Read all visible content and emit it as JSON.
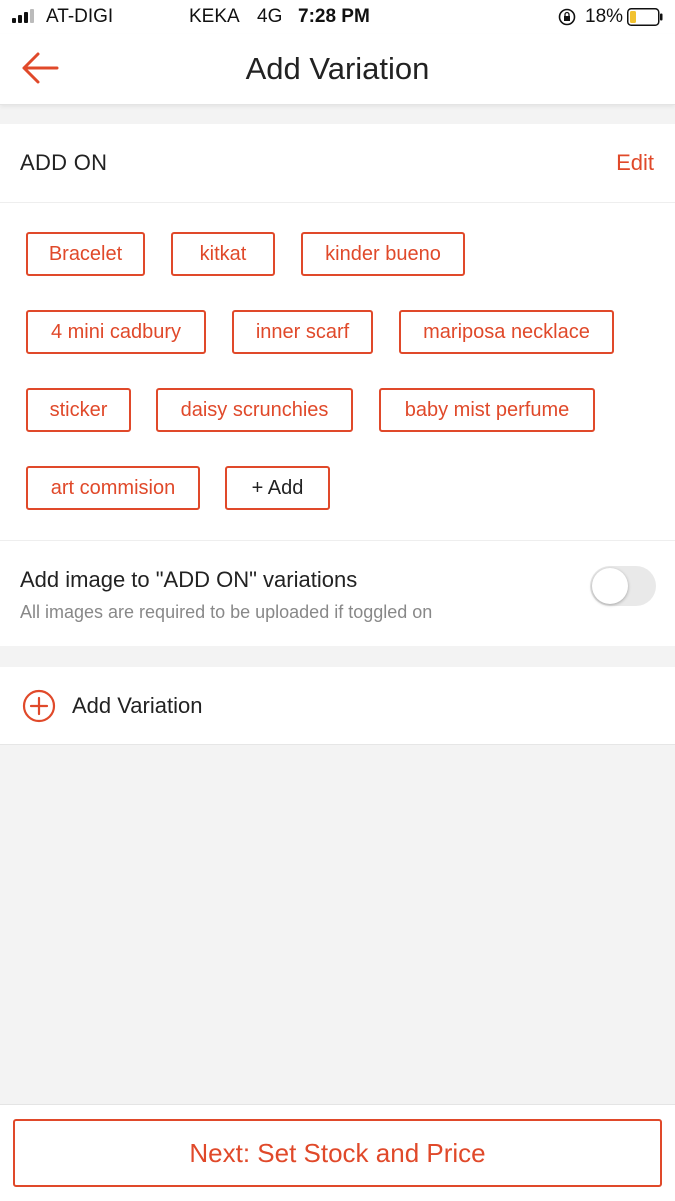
{
  "status_bar": {
    "carrier": "AT-DIGI",
    "carrier_secondary": "KEKA",
    "network": "4G",
    "time": "7:28 PM",
    "battery": "18%"
  },
  "header": {
    "title": "Add Variation",
    "back_icon": "arrow-left-icon"
  },
  "variation": {
    "name": "ADD ON",
    "edit_label": "Edit",
    "options": [
      "Bracelet",
      "kitkat",
      "kinder bueno",
      "4 mini cadbury",
      "inner scarf",
      "mariposa necklace",
      "sticker",
      "daisy scrunchies",
      "baby mist perfume",
      "art commision"
    ],
    "add_option_label": "+ Add",
    "image_toggle": {
      "label": "Add image to \"ADD ON\" variations",
      "hint": "All images are required to be uploaded if toggled on",
      "enabled": false
    }
  },
  "add_variation": {
    "label": "Add Variation",
    "icon": "plus-circle-icon"
  },
  "footer": {
    "next_label": "Next: Set Stock and Price"
  },
  "colors": {
    "accent": "#e0492a",
    "background": "#f3f3f3"
  }
}
